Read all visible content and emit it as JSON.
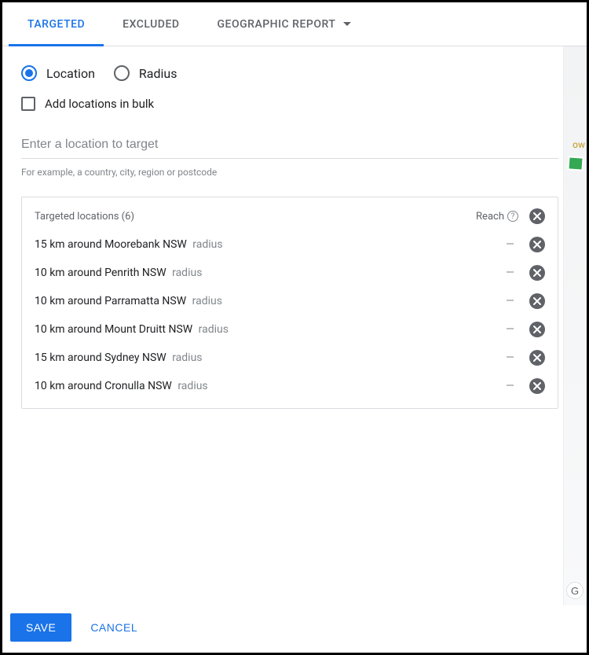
{
  "tabs": {
    "targeted": "TARGETED",
    "excluded": "EXCLUDED",
    "report": "GEOGRAPHIC REPORT"
  },
  "options": {
    "location": "Location",
    "radius": "Radius",
    "bulk": "Add locations in bulk"
  },
  "input": {
    "placeholder": "Enter a location to target",
    "hint": "For example, a country, city, region or postcode"
  },
  "listHeader": {
    "title": "Targeted locations (6)",
    "reach": "Reach"
  },
  "locations": [
    {
      "text": "15 km around Moorebank NSW",
      "subtype": "radius",
      "reach": "—"
    },
    {
      "text": "10 km around Penrith NSW",
      "subtype": "radius",
      "reach": "—"
    },
    {
      "text": "10 km around Parramatta NSW",
      "subtype": "radius",
      "reach": "—"
    },
    {
      "text": "10 km around Mount Druitt NSW",
      "subtype": "radius",
      "reach": "—"
    },
    {
      "text": "15 km around Sydney NSW",
      "subtype": "radius",
      "reach": "—"
    },
    {
      "text": "10 km around Cronulla NSW",
      "subtype": "radius",
      "reach": "—"
    }
  ],
  "footer": {
    "save": "SAVE",
    "cancel": "CANCEL"
  },
  "map": {
    "textFragment": "ow",
    "googleBadge": "G"
  }
}
